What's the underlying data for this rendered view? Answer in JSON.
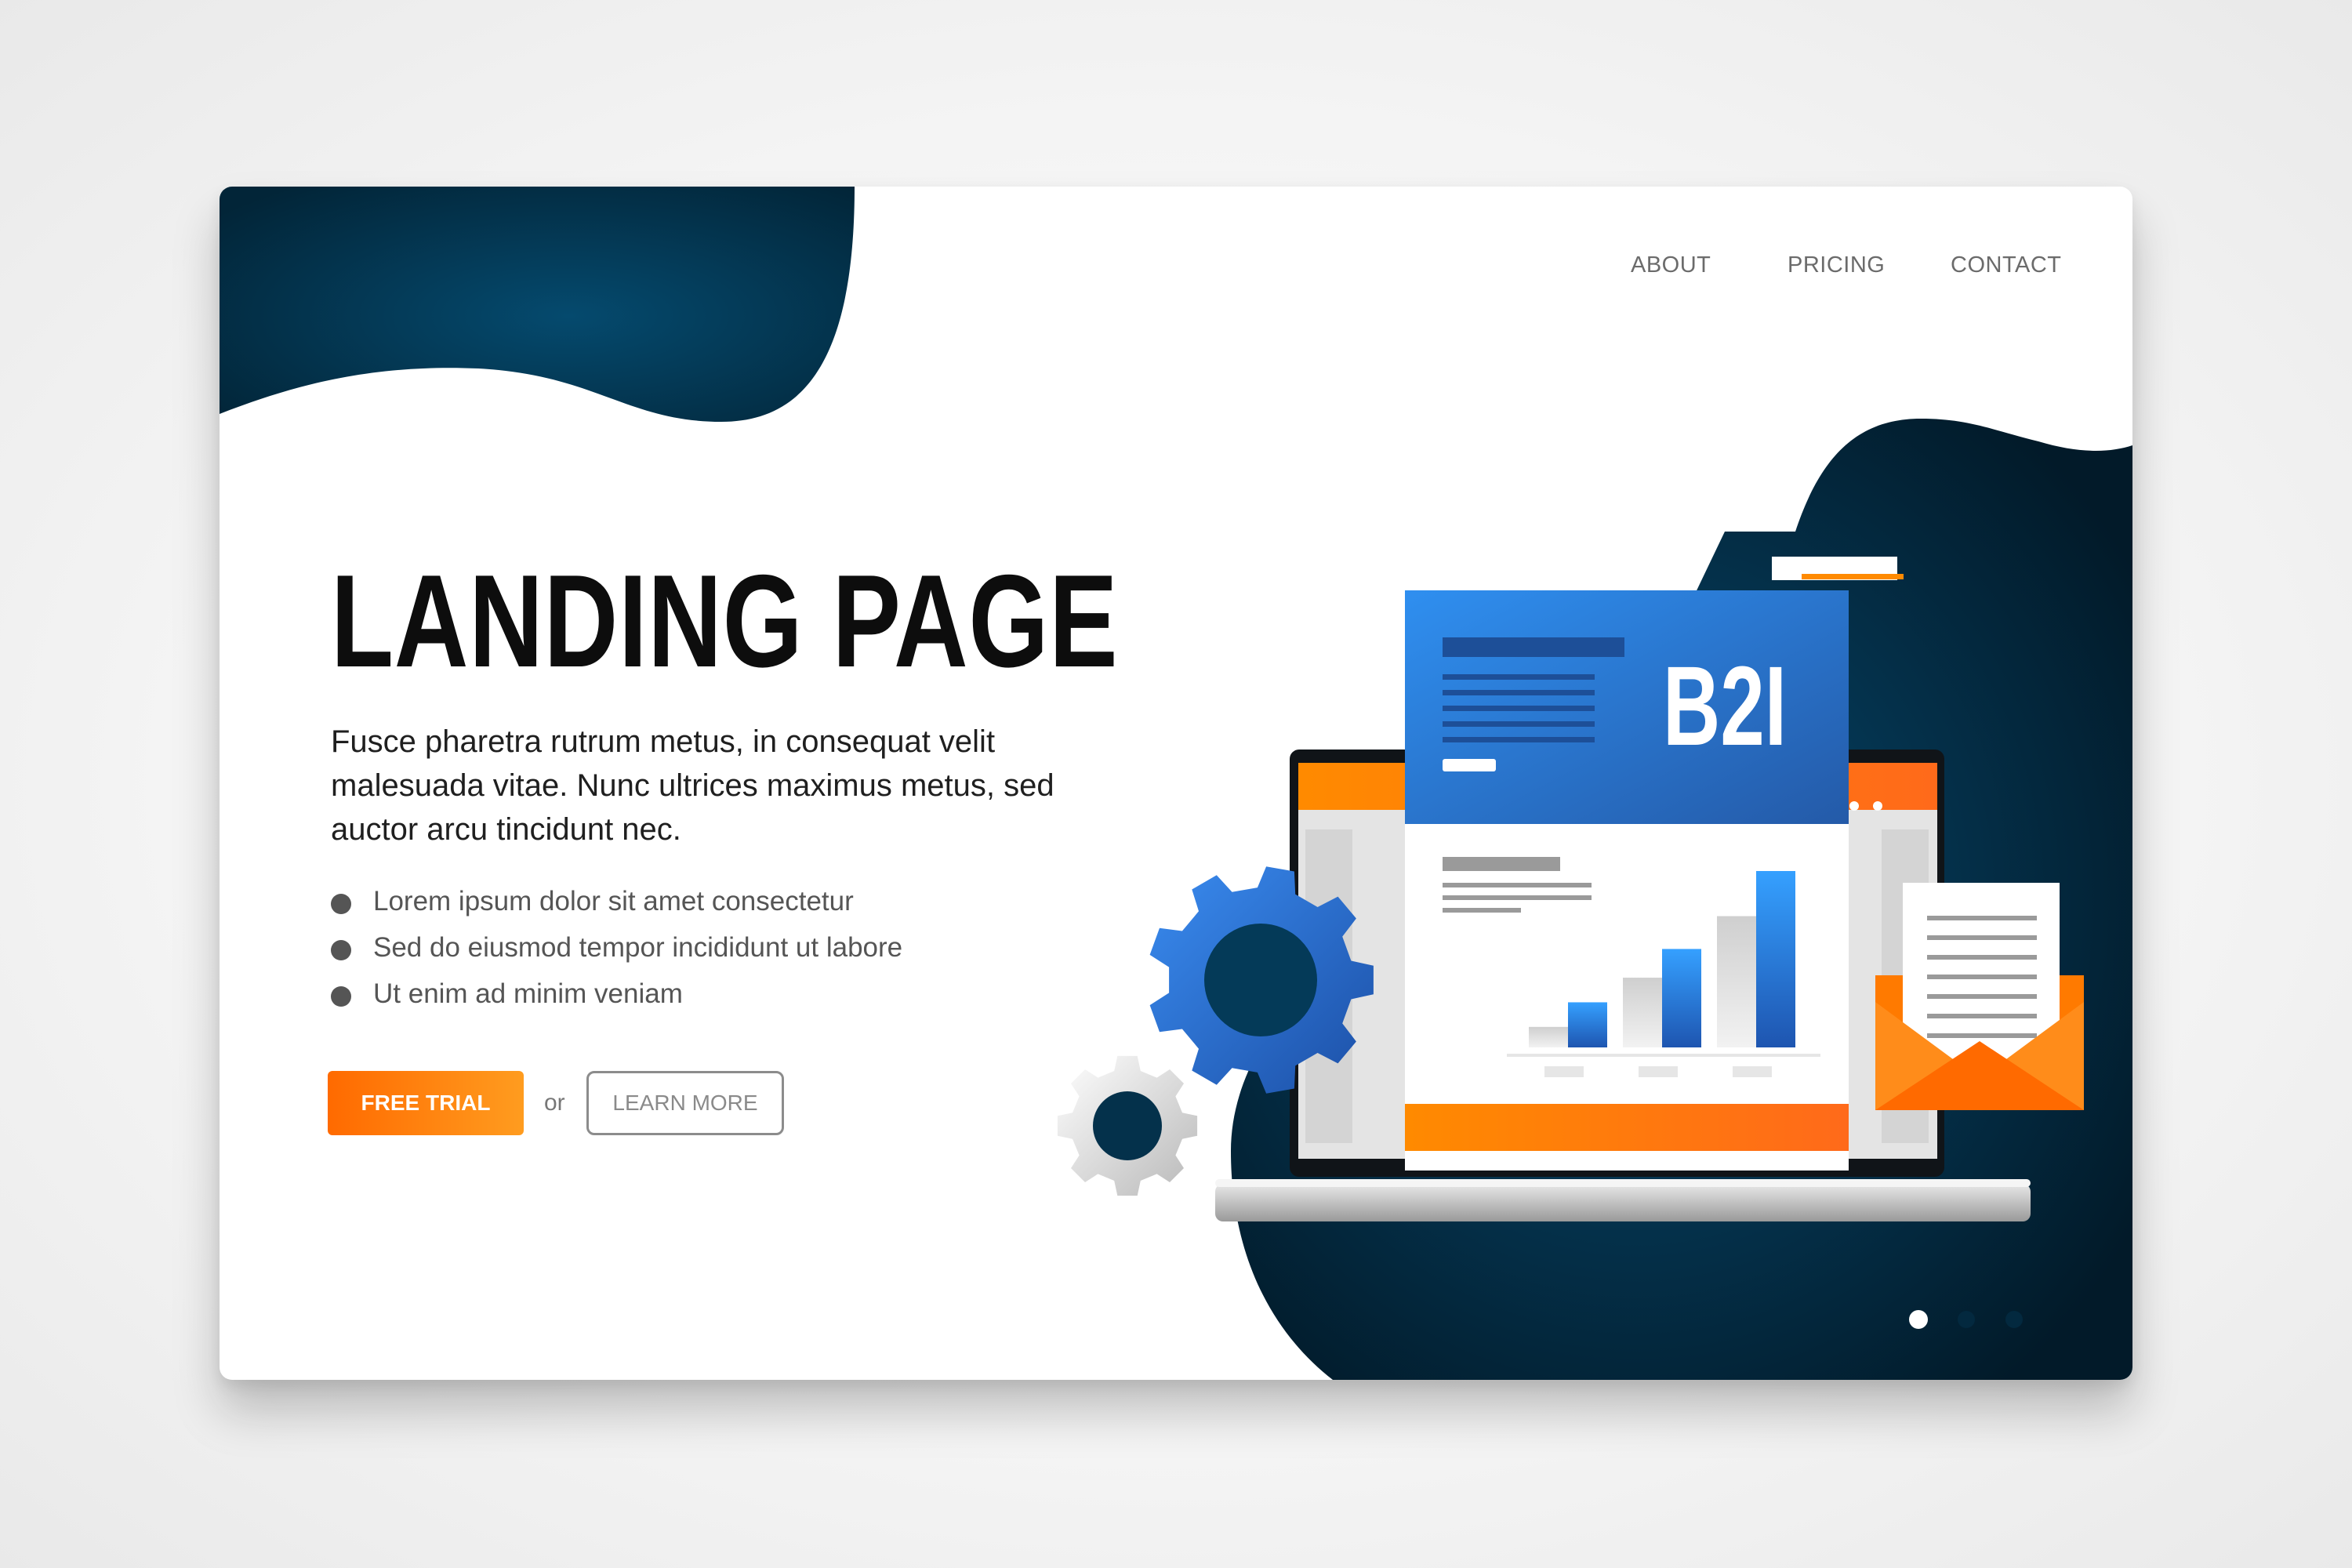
{
  "nav": {
    "about": "ABOUT",
    "pricing": "PRICING",
    "contact": "CONTACT"
  },
  "hero": {
    "title": "LANDING PAGE",
    "description": "Fusce pharetra rutrum metus, in consequat velit malesuada vitae. Nunc ultrices maximus metus, sed auctor arcu tincidunt nec.",
    "features": [
      "Lorem ipsum dolor sit amet consectetur",
      "Sed do eiusmod tempor incididunt ut labore",
      "Ut enim ad minim veniam"
    ],
    "primary_button": "FREE TRIAL",
    "separator": "or",
    "secondary_button": "LEARN MORE"
  },
  "illustration": {
    "badge_text": "B2I",
    "chart_values": [
      25,
      55,
      85,
      120,
      160
    ],
    "icons": [
      "gear-icon",
      "gear-icon",
      "envelope-icon",
      "laptop-icon",
      "document-icon"
    ]
  },
  "pagination": {
    "count": 3,
    "active_index": 0
  },
  "colors": {
    "navy": "#03405f",
    "navy_dark": "#021c2c",
    "accent_orange": "#ff7a00",
    "accent_blue": "#2f7fe0"
  }
}
